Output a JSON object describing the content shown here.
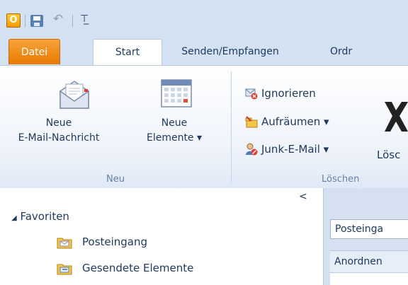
{
  "quick_access": {
    "app_icon": "outlook-icon",
    "app_letter": "O",
    "icons": [
      "save-icon",
      "undo-icon",
      "customize-qat-icon"
    ]
  },
  "tabs": [
    {
      "label": "Datei",
      "active": false
    },
    {
      "label": "Start",
      "active": true
    },
    {
      "label": "Senden/Empfangen",
      "active": false
    },
    {
      "label": "Ordr",
      "active": false
    }
  ],
  "ribbon": {
    "groups": {
      "neu": {
        "label": "Neu",
        "new_mail": {
          "line1": "Neue",
          "line2": "E-Mail-Nachricht"
        },
        "new_items": {
          "line1": "Neue",
          "line2": "Elemente ▾"
        }
      },
      "loeschen": {
        "label": "Löschen",
        "ignore": "Ignorieren",
        "cleanup": "Aufräumen ▾",
        "junk": "Junk-E-Mail ▾",
        "delete": "Lösc"
      }
    }
  },
  "navigation": {
    "favorites_header": "Favoriten",
    "collapse_glyph": "<",
    "items": [
      "Posteingang",
      "Gesendete Elemente"
    ]
  },
  "mail_list": {
    "search_placeholder": "Posteinga",
    "arrange_label": "Anordnen"
  },
  "colors": {
    "file_tab": "#e67a00",
    "ribbon_text": "#1e395b",
    "group_label": "#6580a6",
    "frame": "#d4e1f2"
  }
}
